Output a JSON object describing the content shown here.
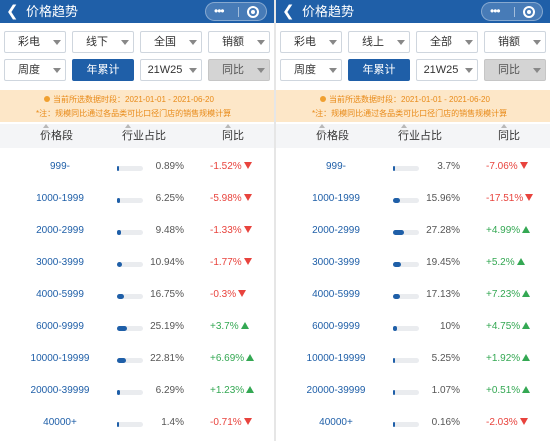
{
  "screens": [
    {
      "title": "价格趋势",
      "filters": {
        "category": "彩电",
        "channel": "线下",
        "region": "全国",
        "metric": "销额",
        "period_type": "周度",
        "cumulative": "年累计",
        "week": "21W25",
        "compare": "同比"
      },
      "notice": {
        "line1": "当前所选数据时段：2021-01-01 - 2021-06-20",
        "line2": "*注：规模同比通过各品类可比口径门店的销售规模计算"
      },
      "columns": {
        "range": "价格段",
        "share": "行业占比",
        "yoy": "同比"
      },
      "rows": [
        {
          "range": "999-",
          "share": "0.89%",
          "share_value": 0.89,
          "yoy": "-1.52%",
          "trend": "down"
        },
        {
          "range": "1000-1999",
          "share": "6.25%",
          "share_value": 6.25,
          "yoy": "-5.98%",
          "trend": "down"
        },
        {
          "range": "2000-2999",
          "share": "9.48%",
          "share_value": 9.48,
          "yoy": "-1.33%",
          "trend": "down"
        },
        {
          "range": "3000-3999",
          "share": "10.94%",
          "share_value": 10.94,
          "yoy": "-1.77%",
          "trend": "down"
        },
        {
          "range": "4000-5999",
          "share": "16.75%",
          "share_value": 16.75,
          "yoy": "-0.3%",
          "trend": "down"
        },
        {
          "range": "6000-9999",
          "share": "25.19%",
          "share_value": 25.19,
          "yoy": "+3.7%",
          "trend": "up"
        },
        {
          "range": "10000-19999",
          "share": "22.81%",
          "share_value": 22.81,
          "yoy": "+6.69%",
          "trend": "up"
        },
        {
          "range": "20000-39999",
          "share": "6.29%",
          "share_value": 6.29,
          "yoy": "+1.23%",
          "trend": "up"
        },
        {
          "range": "40000+",
          "share": "1.4%",
          "share_value": 1.4,
          "yoy": "-0.71%",
          "trend": "down"
        }
      ]
    },
    {
      "title": "价格趋势",
      "filters": {
        "category": "彩电",
        "channel": "线上",
        "region": "全部",
        "metric": "销额",
        "period_type": "周度",
        "cumulative": "年累计",
        "week": "21W25",
        "compare": "同比"
      },
      "notice": {
        "line1": "当前所选数据时段：2021-01-01 - 2021-06-20",
        "line2": "*注：规模同比通过各品类可比口径门店的销售规模计算"
      },
      "columns": {
        "range": "价格段",
        "share": "行业占比",
        "yoy": "同比"
      },
      "rows": [
        {
          "range": "999-",
          "share": "3.7%",
          "share_value": 3.7,
          "yoy": "-7.06%",
          "trend": "down"
        },
        {
          "range": "1000-1999",
          "share": "15.96%",
          "share_value": 15.96,
          "yoy": "-17.51%",
          "trend": "down"
        },
        {
          "range": "2000-2999",
          "share": "27.28%",
          "share_value": 27.28,
          "yoy": "+4.99%",
          "trend": "up"
        },
        {
          "range": "3000-3999",
          "share": "19.45%",
          "share_value": 19.45,
          "yoy": "+5.2%",
          "trend": "up"
        },
        {
          "range": "4000-5999",
          "share": "17.13%",
          "share_value": 17.13,
          "yoy": "+7.23%",
          "trend": "up"
        },
        {
          "range": "6000-9999",
          "share": "10%",
          "share_value": 10,
          "yoy": "+4.75%",
          "trend": "up"
        },
        {
          "range": "10000-19999",
          "share": "5.25%",
          "share_value": 5.25,
          "yoy": "+1.92%",
          "trend": "up"
        },
        {
          "range": "20000-39999",
          "share": "1.07%",
          "share_value": 1.07,
          "yoy": "+0.51%",
          "trend": "up"
        },
        {
          "range": "40000+",
          "share": "0.16%",
          "share_value": 0.16,
          "yoy": "-2.03%",
          "trend": "down"
        }
      ]
    }
  ],
  "colors": {
    "header": "#1f5fa8",
    "bar_fill": "#1f5fa8",
    "negative": "#e8433d",
    "positive": "#34a853",
    "notice_bg": "#fde7c8",
    "notice_text": "#e88a18"
  }
}
